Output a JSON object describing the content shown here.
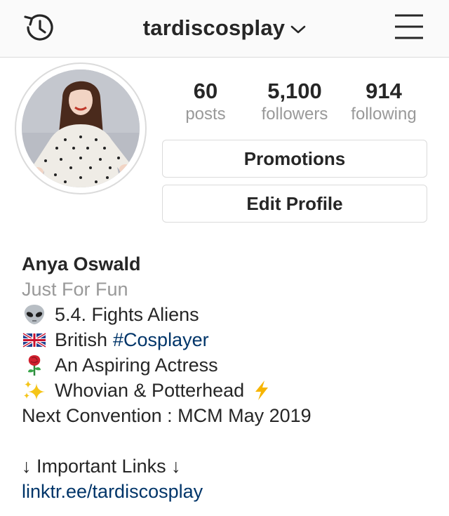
{
  "header": {
    "username": "tardiscosplay",
    "history_icon": "history-clock-icon",
    "dropdown_icon": "chevron-down-icon",
    "menu_icon": "hamburger-menu-icon"
  },
  "profile": {
    "avatar_icon": "profile-avatar",
    "stats": {
      "posts": {
        "value": "60",
        "label": "posts"
      },
      "followers": {
        "value": "5,100",
        "label": "followers"
      },
      "following": {
        "value": "914",
        "label": "following"
      }
    },
    "buttons": {
      "promotions": "Promotions",
      "edit_profile": "Edit Profile"
    }
  },
  "bio": {
    "name": "Anya Oswald",
    "category": "Just For Fun",
    "lines": [
      {
        "emoji": "alien-icon",
        "text": "5.4. Fights Aliens"
      },
      {
        "emoji": "uk-flag-icon",
        "text": "British",
        "hashtag": "#Cosplayer"
      },
      {
        "emoji": "rose-icon",
        "text": "An Aspiring Actress"
      },
      {
        "emoji": "sparkles-icon",
        "text": "Whovian & Potterhead",
        "trailing_emoji": "lightning-icon"
      }
    ],
    "convention": "Next Convention : MCM May 2019",
    "links_header": "↓ Important Links ↓",
    "link": "linktr.ee/tardiscosplay"
  },
  "colors": {
    "text": "#262626",
    "muted": "#999999",
    "link": "#003569",
    "border": "#dbdbdb",
    "header_bg": "#fafafa"
  }
}
